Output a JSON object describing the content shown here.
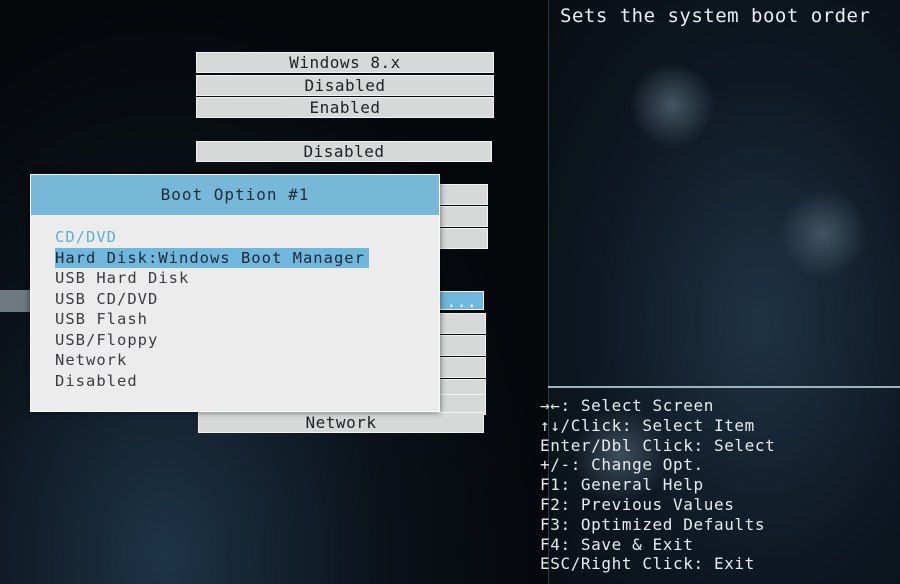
{
  "description": {
    "text": "Sets the system boot order"
  },
  "settings": [
    {
      "value": "Windows 8.x"
    },
    {
      "value": "Disabled"
    },
    {
      "value": "Enabled"
    },
    {
      "value": "Disabled"
    },
    {
      "value": "Network"
    }
  ],
  "popup": {
    "title": "Boot Option #1",
    "options": [
      "CD/DVD",
      "Hard Disk:Windows Boot Manager",
      "USB Hard Disk",
      "USB CD/DVD",
      "USB Flash",
      "USB/Floppy",
      "Network",
      "Disabled"
    ],
    "selected_index": 1
  },
  "help": {
    "lines": [
      "→←: Select Screen",
      "↑↓/Click: Select Item",
      "Enter/Dbl Click: Select",
      "+/-: Change Opt.",
      "F1: General Help",
      "F2: Previous Values",
      "F3: Optimized Defaults",
      "F4: Save & Exit",
      "ESC/Right Click: Exit"
    ]
  },
  "colors": {
    "accent": "#6fb7dc",
    "popup_bg": "#ececec",
    "setting_bg": "#d6d9d8"
  }
}
